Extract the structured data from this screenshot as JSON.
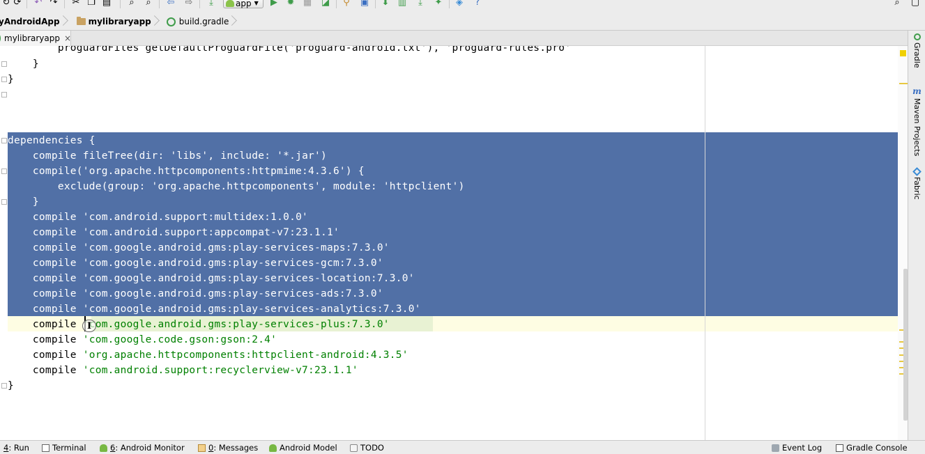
{
  "toolbar": {
    "run_config": "app",
    "icons": [
      "sync-icon",
      "undo-icon",
      "redo-icon",
      "cut-icon",
      "copy-icon",
      "paste-icon",
      "find-icon",
      "replace-icon",
      "back-icon",
      "forward-icon",
      "make-icon",
      "run-icon",
      "debug-icon",
      "attach-icon",
      "coverage-icon",
      "structure-icon",
      "sdk-manager-icon",
      "avd-manager-icon",
      "help-icon",
      "search-everywhere-icon"
    ]
  },
  "breadcrumb": {
    "items": [
      {
        "label": "yAndroidApp",
        "bold": true
      },
      {
        "label": "mylibraryapp",
        "bold": true
      },
      {
        "label": "build.gradle",
        "bold": false
      }
    ]
  },
  "editor_tab": {
    "label": "mylibraryapp",
    "close": "×"
  },
  "code": {
    "line1": "        proguardFiles getDefaultProguardFile('proguard-android.txt'), 'proguard-rules.pro'",
    "line2": "    }",
    "line3": "}",
    "line4": "",
    "line5_kw": "dependencies {",
    "deps": [
      {
        "kw": "    compile fileTree(dir: ",
        "str": "'libs'",
        "rest": ", include: ",
        "str2": "'*.jar'",
        "end": ")"
      },
      {
        "kw": "    compile(",
        "str": "'org.apache.httpcomponents:httpmime:4.3.6'",
        "rest": ") {",
        "str2": "",
        "end": ""
      },
      {
        "kw": "        exclude(group: ",
        "str": "'org.apache.httpcomponents'",
        "rest": ", module: ",
        "str2": "'httpclient'",
        "end": ")"
      },
      {
        "kw": "    }",
        "str": "",
        "rest": "",
        "str2": "",
        "end": ""
      },
      {
        "kw": "    compile ",
        "str": "'com.android.support:multidex:1.0.0'",
        "rest": "",
        "str2": "",
        "end": ""
      },
      {
        "kw": "    compile ",
        "str": "'com.android.support:appcompat-v7:23.1.1'",
        "rest": "",
        "str2": "",
        "end": ""
      },
      {
        "kw": "    compile ",
        "str": "'com.google.android.gms:play-services-maps:7.3.0'",
        "rest": "",
        "str2": "",
        "end": ""
      },
      {
        "kw": "    compile ",
        "str": "'com.google.android.gms:play-services-gcm:7.3.0'",
        "rest": "",
        "str2": "",
        "end": ""
      },
      {
        "kw": "    compile ",
        "str": "'com.google.android.gms:play-services-location:7.3.0'",
        "rest": "",
        "str2": "",
        "end": ""
      },
      {
        "kw": "    compile ",
        "str": "'com.google.android.gms:play-services-ads:7.3.0'",
        "rest": "",
        "str2": "",
        "end": ""
      },
      {
        "kw": "    compile ",
        "str": "'com.google.android.gms:play-services-analytics:7.3.0'",
        "rest": "",
        "str2": "",
        "end": ""
      },
      {
        "kw": "    compile ",
        "str": "'com.google.android.gms:play-services-plus:7.3.0'",
        "rest": "",
        "str2": "",
        "end": ""
      },
      {
        "kw": "    compile ",
        "str": "'com.google.code.gson:gson:2.4'",
        "rest": "",
        "str2": "",
        "end": ""
      },
      {
        "kw": "    compile ",
        "str": "'org.apache.httpcomponents:httpclient-android:4.3.5'",
        "rest": "",
        "str2": "",
        "end": ""
      },
      {
        "kw": "    compile ",
        "str": "'com.android.support:recyclerview-v7:23.1.1'",
        "rest": "",
        "str2": "",
        "end": ""
      }
    ],
    "closing": "}"
  },
  "right_tools": [
    {
      "label": "Gradle"
    },
    {
      "label": "Maven Projects"
    },
    {
      "label": "Fabric"
    }
  ],
  "status_bar": {
    "run": {
      "num": "4",
      "label": ": Run"
    },
    "terminal": "Terminal",
    "android_monitor": {
      "num": "6",
      "label": ": Android Monitor"
    },
    "messages": {
      "num": "0",
      "label": ": Messages"
    },
    "android_model": "Android Model",
    "todo": "TODO",
    "event_log": "Event Log",
    "gradle_console": "Gradle Console"
  },
  "colors": {
    "selection": "#5170a6",
    "string": "#008000",
    "caret_line": "#fefde3"
  }
}
